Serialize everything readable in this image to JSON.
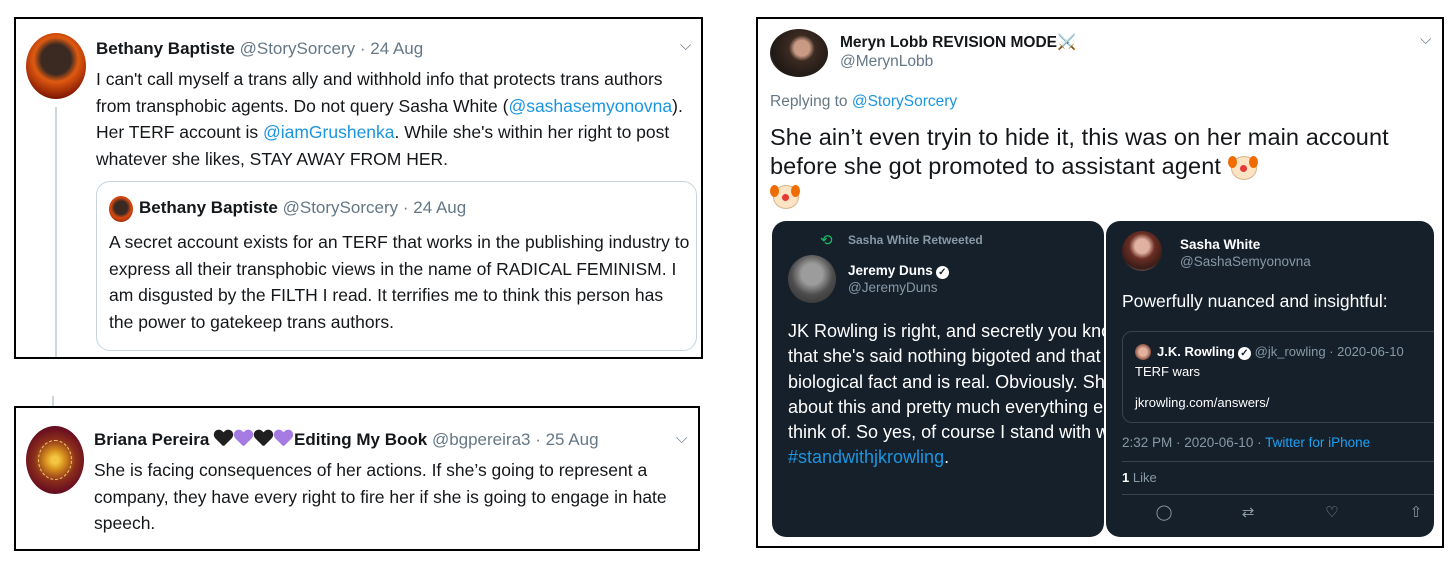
{
  "tweet_a": {
    "name": "Bethany Baptiste",
    "handle": "@StorySorcery",
    "date": "· 24 Aug",
    "text_1": "I can't call myself a trans ally and withhold info that protects trans authors from transphobic agents. Do not query Sasha White (",
    "mention_1": "@sashasemyonovna",
    "text_2": "). Her TERF account is ",
    "mention_2": "@iamGrushenka",
    "text_3": ". While she's within her right to post whatever she likes, STAY AWAY FROM HER.",
    "quote": {
      "name": "Bethany Baptiste",
      "handle": "@StorySorcery",
      "date": "· 24 Aug",
      "text": "A secret account exists for an TERF that works in the publishing industry to express all their transphobic views in the name of RADICAL FEMINISM. I am disgusted by the FILTH I read. It terrifies me to think this person has the power to gatekeep trans authors."
    }
  },
  "tweet_b": {
    "name": "Briana Pereira",
    "name_suffix": "Editing My Book",
    "hearts": [
      "#1f1f1f",
      "#a57be3",
      "#1f1f1f",
      "#a57be3"
    ],
    "handle": "@bgpereira3",
    "date": "· 25 Aug",
    "text": "She is facing consequences of her actions. If she’s going to represent a company, they have every right to fire her if she is going to engage in hate speech."
  },
  "tweet_c": {
    "name": "Meryn Lobb REVISION MODE⚔️",
    "handle": "@MerynLobb",
    "replying_label": "Replying to ",
    "replying_to": "@StorySorcery",
    "text": "She ain’t even tryin to hide it, this was on her main account before she got promoted to assistant agent ",
    "left_card": {
      "retweeted_by": "Sasha White Retweeted",
      "name": "Jeremy Duns",
      "handle": "@JeremyDuns",
      "text": "JK Rowling is right, and secretly you know she is, that she's said nothing bigoted and that sex is a biological fact and is real. Obviously. She's right about this and pretty much everything else I can think of. So yes, of course I stand with women and I ",
      "hashtag": "#standwithjkrowling",
      "text_end": "."
    },
    "right_card": {
      "name": "Sasha White",
      "handle": "@SashaSemyonovna",
      "text": "Powerfully nuanced and insightful:",
      "quoted": {
        "name": "J.K. Rowling",
        "handle_date": "@jk_rowling · 2020-06-10",
        "text": "TERF wars",
        "link": "jkrowling.com/answers/"
      },
      "time": "2:32 PM · 2020-06-10 · ",
      "source": "Twitter for iPhone",
      "likes_count": "1",
      "likes_label": " Like"
    }
  },
  "icons": {
    "chevron": "⌵",
    "retweet": "⟲",
    "reply": "◯",
    "rt": "⇄",
    "like": "♡",
    "share": "⇧"
  }
}
